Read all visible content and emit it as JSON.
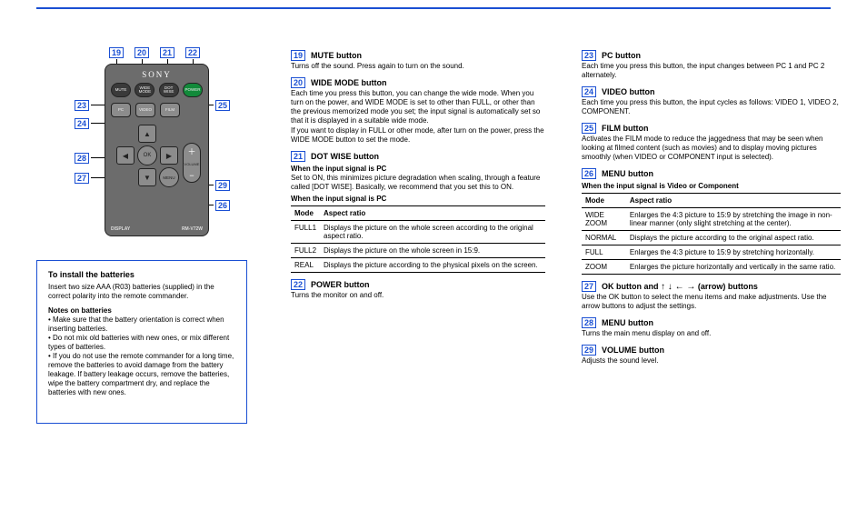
{
  "remote": {
    "brand": "SONY",
    "row1": [
      "MUTE",
      "WIDE\nMODE",
      "DOT\nWISE",
      "POWER"
    ],
    "row2": [
      "PC",
      "VIDEO",
      "FILM"
    ],
    "pad": {
      "up": "▲",
      "down": "▼",
      "left": "◀",
      "right": "▶",
      "ok": "OK",
      "menu": "MENU"
    },
    "vol": {
      "plus": "＋",
      "minus": "−",
      "label": "VOLUME"
    },
    "footer_left": "DISPLAY",
    "footer_right": "RM-V72W"
  },
  "callouts": {
    "top": [
      "19",
      "20",
      "21",
      "22"
    ],
    "left": [
      "23",
      "24",
      "28",
      "27"
    ],
    "right": [
      "25",
      "29",
      "26"
    ]
  },
  "battery_box": {
    "title": "To install the batteries",
    "body": "Insert two size AAA (R03) batteries (supplied) in the correct polarity into the remote commander.",
    "notes_title": "Notes on batteries",
    "notes": [
      "Make sure that the battery orientation is correct when inserting batteries.",
      "Do not mix old batteries with new ones, or mix different types of batteries.",
      "If you do not use the remote commander for a long time, remove the batteries to avoid damage from the battery leakage. If battery leakage occurs, remove the batteries, wipe the battery compartment dry, and replace the batteries with new ones."
    ]
  },
  "col2": {
    "i19": {
      "num": "19",
      "label": "MUTE button",
      "body": "Turns off the sound. Press again to turn on the sound."
    },
    "i20": {
      "num": "20",
      "label": "WIDE MODE button",
      "body": "Each time you press this button, you can change the wide mode. When you turn on the power, and WIDE MODE is set to other than FULL, or other than the previous memorized mode you set; the input signal is automatically set so that it is displayed in a suitable wide mode.",
      "sub1": "If you want to display in FULL or other mode, after turn on the power, press the WIDE MODE button to set the mode.",
      "sub2": "When the input signal is PC",
      "tablePC": {
        "head": [
          "Mode",
          "Aspect ratio"
        ],
        "rows": [
          [
            "FULL1",
            "Displays the picture on the whole screen according to the original aspect ratio."
          ],
          [
            "FULL2",
            "Displays the picture on the whole screen in 15:9."
          ],
          [
            "REAL",
            "Displays the picture according to the physical pixels on the screen."
          ]
        ]
      }
    },
    "i21": {
      "num": "21",
      "label": "DOT WISE button",
      "sub": "When the input signal is PC",
      "body": "Set to ON, this minimizes picture degradation when scaling, through a feature called [DOT WISE]. Basically, we recommend that you set this to ON."
    },
    "i22": {
      "num": "22",
      "label": "POWER button",
      "body": "Turns the monitor on and off."
    }
  },
  "col3": {
    "i23": {
      "num": "23",
      "label": "PC button",
      "body": "Each time you press this button, the input changes between PC 1 and PC 2 alternately."
    },
    "i24": {
      "num": "24",
      "label": "VIDEO button",
      "body": "Each time you press this button, the input cycles as follows: VIDEO 1, VIDEO 2, COMPONENT."
    },
    "i25": {
      "num": "25",
      "label": "FILM button",
      "body": "Activates the FILM mode to reduce the jaggedness that may be seen when looking at filmed content (such as movies) and to display moving pictures smoothly (when VIDEO or COMPONENT input is selected)."
    },
    "i26": {
      "num": "26",
      "label": "MENU button",
      "sub": "When the input signal is Video or Component",
      "table": {
        "head": [
          "Mode",
          "Aspect ratio"
        ],
        "rows": [
          [
            "WIDE ZOOM",
            "Enlarges the 4:3 picture to 15:9 by stretching the image in non-linear manner (only slight stretching at the center)."
          ],
          [
            "NORMAL",
            "Displays the picture according to the original aspect ratio."
          ],
          [
            "FULL",
            "Enlarges the 4:3 picture to 15:9 by stretching horizontally."
          ],
          [
            "ZOOM",
            "Enlarges the picture horizontally and vertically in the same ratio."
          ]
        ]
      }
    },
    "i27": {
      "num": "27",
      "label": "OK button and ",
      "arrows": "↑ ↓ ← →",
      "label2": " (arrow) buttons",
      "body": "Use the OK button to select the menu items and make adjustments. Use the arrow buttons to adjust the settings."
    },
    "i28": {
      "num": "28",
      "label": "MENU button",
      "body": "Turns the main menu display on and off."
    },
    "i29": {
      "num": "29",
      "label": "VOLUME button",
      "body": "Adjusts the sound level."
    }
  }
}
